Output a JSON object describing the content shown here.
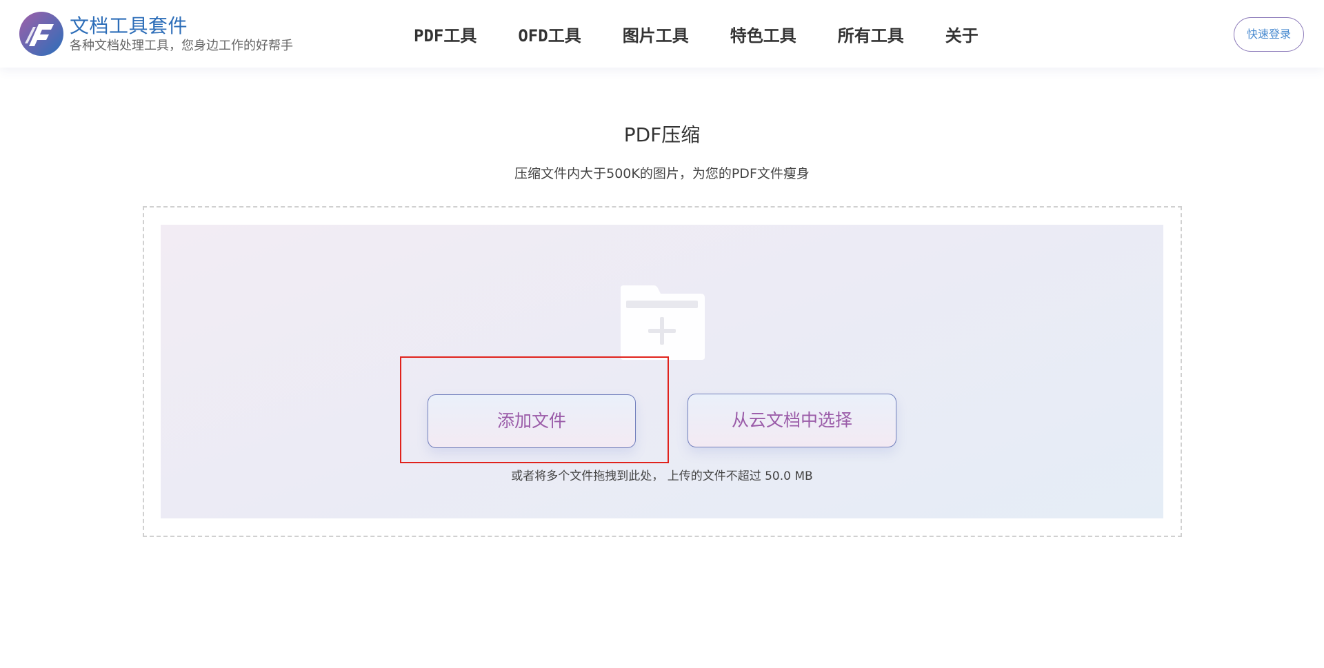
{
  "header": {
    "brand_title": "文档工具套件",
    "brand_slogan": "各种文档处理工具，您身边工作的好帮手",
    "logo_icon": "document-suite-logo-icon",
    "nav": [
      {
        "label": "PDF工具"
      },
      {
        "label": "OFD工具"
      },
      {
        "label": "图片工具"
      },
      {
        "label": "特色工具"
      },
      {
        "label": "所有工具"
      },
      {
        "label": "关于"
      }
    ],
    "login_label": "快速登录"
  },
  "main": {
    "title": "PDF压缩",
    "description": "压缩文件内大于500K的图片，为您的PDF文件瘦身",
    "upload": {
      "folder_icon": "folder-add-icon",
      "add_file_label": "添加文件",
      "cloud_select_label": "从云文档中选择",
      "drop_hint": "或者将多个文件拖拽到此处， 上传的文件不超过 50.0 MB"
    }
  },
  "colors": {
    "brand_blue": "#2c6db8",
    "button_text": "#9a5ba8",
    "button_border": "#6f7dbb",
    "highlight_red": "#e0221c",
    "login_text": "#4a8bd0"
  }
}
